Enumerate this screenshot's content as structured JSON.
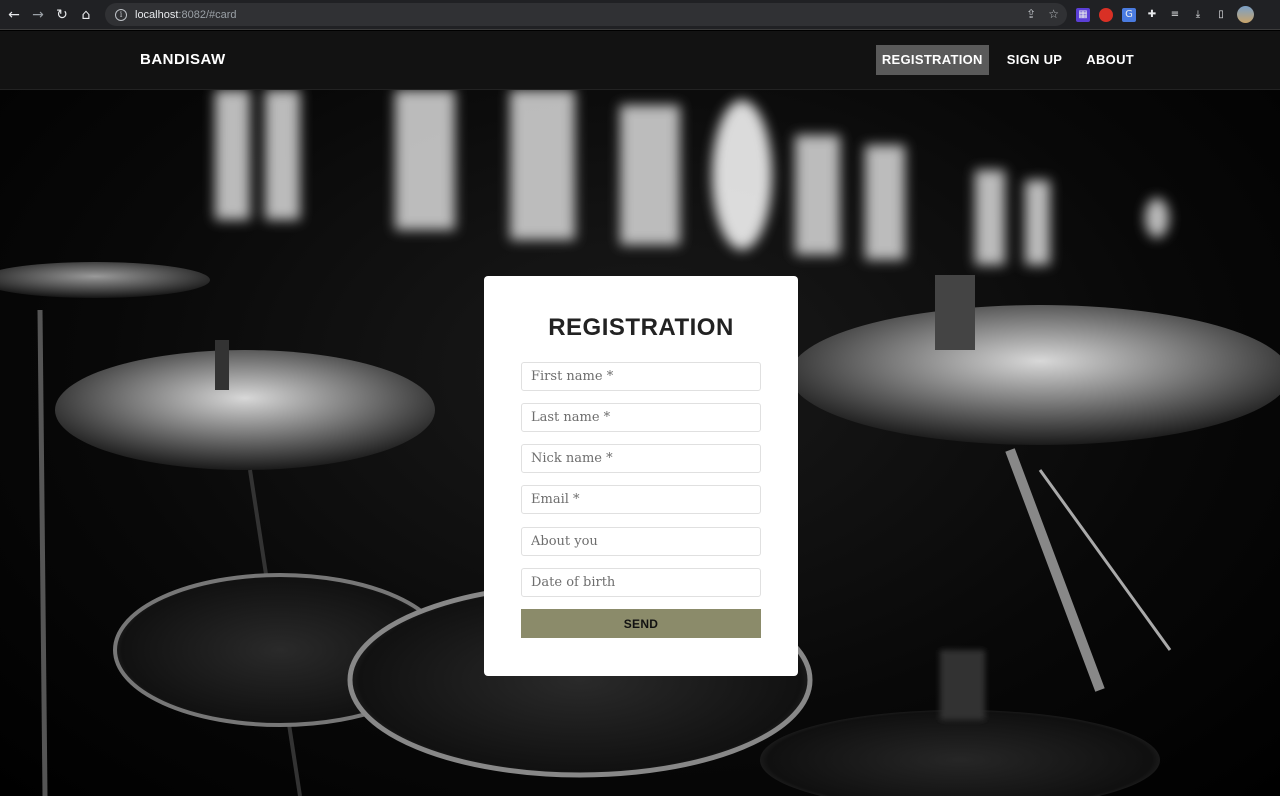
{
  "browser": {
    "url_host": "localhost",
    "url_rest": ":8082/#card"
  },
  "site": {
    "brand": "BANDISAW",
    "nav": {
      "registration": "REGISTRATION",
      "signup": "SIGN UP",
      "about": "ABOUT"
    }
  },
  "form": {
    "title": "REGISTRATION",
    "fields": {
      "first_name": "First name *",
      "last_name": "Last name *",
      "nick_name": "Nick name *",
      "email": "Email *",
      "about": "About you",
      "dob": "Date of birth"
    },
    "submit": "SEND"
  },
  "colors": {
    "header_bg": "#121212",
    "active_nav_bg": "#5a5a5a",
    "send_button": "#8b8b6a",
    "card_bg": "#ffffff"
  }
}
